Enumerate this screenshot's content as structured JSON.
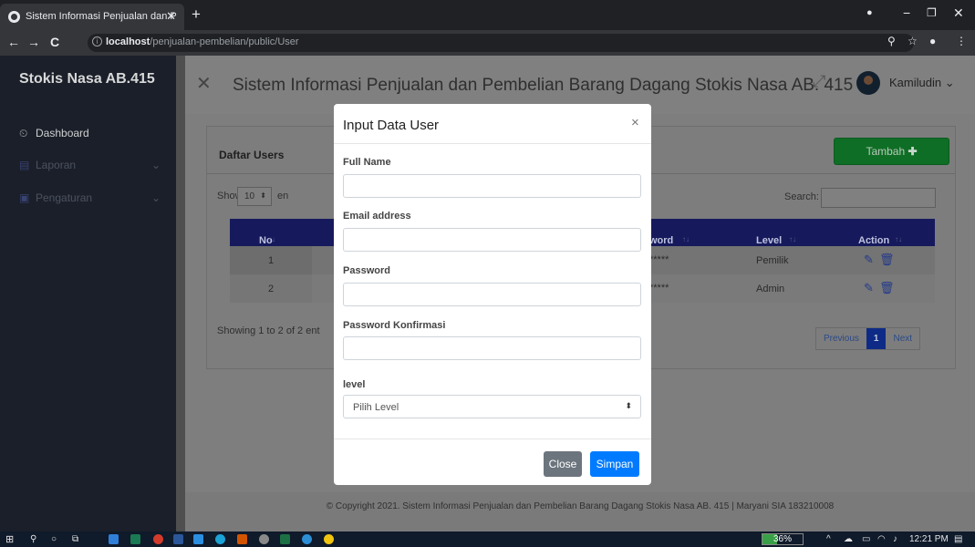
{
  "browser": {
    "tab_title": "Sistem Informasi Penjualan dan P",
    "tab_close": "✕",
    "new_tab": "+",
    "url_host": "localhost",
    "url_path": "/penjualan-pembelian/public/User"
  },
  "sidebar": {
    "brand": "Stokis Nasa AB.415",
    "items": [
      {
        "label": "Dashboard",
        "icon": "dashboard-icon"
      },
      {
        "label": "Laporan",
        "icon": "report-icon"
      },
      {
        "label": "Pengaturan",
        "icon": "settings-icon"
      }
    ]
  },
  "header": {
    "title": "Sistem Informasi Penjualan dan Pembelian Barang Dagang Stokis Nasa AB. 415",
    "user_name": "Kamiludin"
  },
  "card": {
    "title": "Daftar Users",
    "add_button": "Tambah",
    "show_label": "Show",
    "entries_label": "en",
    "page_length": "10",
    "search_label": "Search:",
    "columns": [
      "No",
      "word",
      "Level",
      "Action"
    ],
    "rows": [
      {
        "no": "1",
        "password": "*****",
        "level": "Pemilik"
      },
      {
        "no": "2",
        "password": "*****",
        "level": "Admin"
      }
    ],
    "info": "Showing 1 to 2 of 2 ent",
    "pagination": {
      "previous": "Previous",
      "current": "1",
      "next": "Next"
    }
  },
  "footer": {
    "text": "© Copyright 2021. Sistem Informasi Penjualan dan Pembelian Barang Dagang Stokis Nasa AB. 415 | Maryani SIA 183210008"
  },
  "modal": {
    "title": "Input Data User",
    "close_icon": "×",
    "fields": {
      "full_name": {
        "label": "Full Name",
        "value": ""
      },
      "email": {
        "label": "Email address",
        "value": ""
      },
      "password": {
        "label": "Password",
        "value": ""
      },
      "password_confirm": {
        "label": "Password Konfirmasi",
        "value": ""
      },
      "level": {
        "label": "level",
        "selected": "Pilih Level"
      }
    },
    "close_button": "Close",
    "save_button": "Simpan"
  },
  "taskbar": {
    "battery": "36%",
    "battery_level": 0.36,
    "time": "12:21 PM"
  },
  "colors": {
    "primary": "#007bff",
    "secondary": "#6c757d",
    "success": "#28a745",
    "sidebar": "#1a1f2a"
  }
}
